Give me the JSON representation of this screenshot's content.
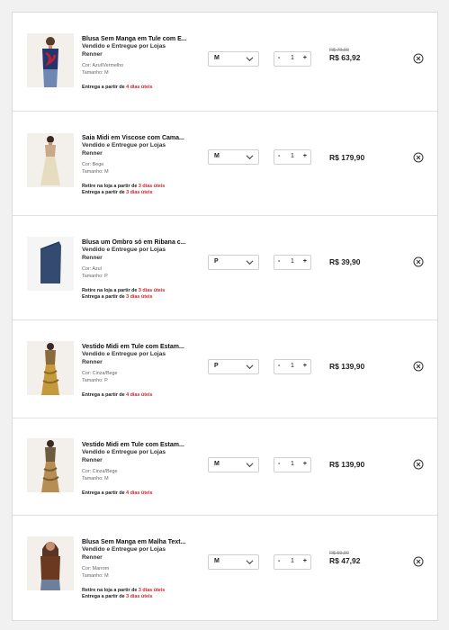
{
  "ui": {
    "qty_minus": "-",
    "qty_plus": "+",
    "delivery_prefix": "Entrega a partir de ",
    "pickup_prefix": "Retire na loja a partir de ",
    "icons": {
      "remove": "close-circle-icon",
      "dropdown": "chevron-down-icon"
    }
  },
  "cart_items": [
    {
      "name": "Blusa Sem Manga em Tule com E...",
      "seller_line1": "Vendido e Entregue por Lojas",
      "seller_line2": "Renner",
      "color": "Cor: Azul/Vermelho",
      "size_label": "Tamanho: M",
      "pickup_days": "",
      "delivery_days": "4 dias úteis",
      "size_selected": "M",
      "quantity": "1",
      "old_price": "R$ 79,90",
      "price": "R$ 63,92"
    },
    {
      "name": "Saia Midi em Viscose com Cama...",
      "seller_line1": "Vendido e Entregue por Lojas",
      "seller_line2": "Renner",
      "color": "Cor: Bege",
      "size_label": "Tamanho: M",
      "pickup_days": "3 dias úteis",
      "delivery_days": "3 dias úteis",
      "size_selected": "M",
      "quantity": "1",
      "old_price": "",
      "price": "R$ 179,90"
    },
    {
      "name": "Blusa um Ombro só em Ribana c...",
      "seller_line1": "Vendido e Entregue por Lojas",
      "seller_line2": "Renner",
      "color": "Cor: Azul",
      "size_label": "Tamanho: P",
      "pickup_days": "3 dias úteis",
      "delivery_days": "3 dias úteis",
      "size_selected": "P",
      "quantity": "1",
      "old_price": "",
      "price": "R$ 39,90"
    },
    {
      "name": "Vestido Midi em Tule com Estam...",
      "seller_line1": "Vendido e Entregue por Lojas",
      "seller_line2": "Renner",
      "color": "Cor: Cinza/Bege",
      "size_label": "Tamanho: P",
      "pickup_days": "",
      "delivery_days": "4 dias úteis",
      "size_selected": "P",
      "quantity": "1",
      "old_price": "",
      "price": "R$ 139,90"
    },
    {
      "name": "Vestido Midi em Tule com Estam...",
      "seller_line1": "Vendido e Entregue por Lojas",
      "seller_line2": "Renner",
      "color": "Cor: Cinza/Bege",
      "size_label": "Tamanho: M",
      "pickup_days": "",
      "delivery_days": "4 dias úteis",
      "size_selected": "M",
      "quantity": "1",
      "old_price": "",
      "price": "R$ 139,90"
    },
    {
      "name": "Blusa Sem Manga em Malha Text...",
      "seller_line1": "Vendido e Entregue por Lojas",
      "seller_line2": "Renner",
      "color": "Cor: Marrom",
      "size_label": "Tamanho: M",
      "pickup_days": "3 dias úteis",
      "delivery_days": "3 dias úteis",
      "size_selected": "M",
      "quantity": "1",
      "old_price": "R$ 59,90",
      "price": "R$ 47,92"
    }
  ],
  "colors": {
    "accent_red": "#d3242b",
    "text": "#222222",
    "muted": "#666666"
  }
}
